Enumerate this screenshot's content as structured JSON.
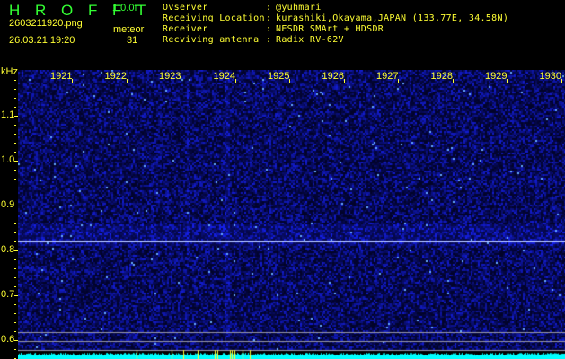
{
  "header": {
    "logo": "H R O F F T",
    "version": "1.0.0f",
    "filename": "2603211920.png",
    "datetime": "26.03.21 19:20",
    "meteor_label": "meteor",
    "meteor_count": "31"
  },
  "info": [
    {
      "label": "Ovserver",
      "value": "@yuhmari"
    },
    {
      "label": "Receiving Location",
      "value": "kurashiki,Okayama,JAPAN (133.77E, 34.58N)"
    },
    {
      "label": "Receiver",
      "value": "NESDR SMArt + HDSDR"
    },
    {
      "label": "Recviving antenna",
      "value": "Radix RV-62V"
    }
  ],
  "axis": {
    "unit": "kHz",
    "y_ticks": [
      "1.1",
      "1.0",
      "0.9",
      "0.8",
      "0.7",
      "0.6"
    ],
    "x_ticks": [
      "1921",
      "1922",
      "1923",
      "1924",
      "1925",
      "1926",
      "1927",
      "1928",
      "1929",
      "1930"
    ]
  },
  "colors": {
    "text": "#ffff33",
    "logo": "#33ff33",
    "background": "#000010",
    "signal": "#2a3cff",
    "baseline": "#00ffff"
  }
}
